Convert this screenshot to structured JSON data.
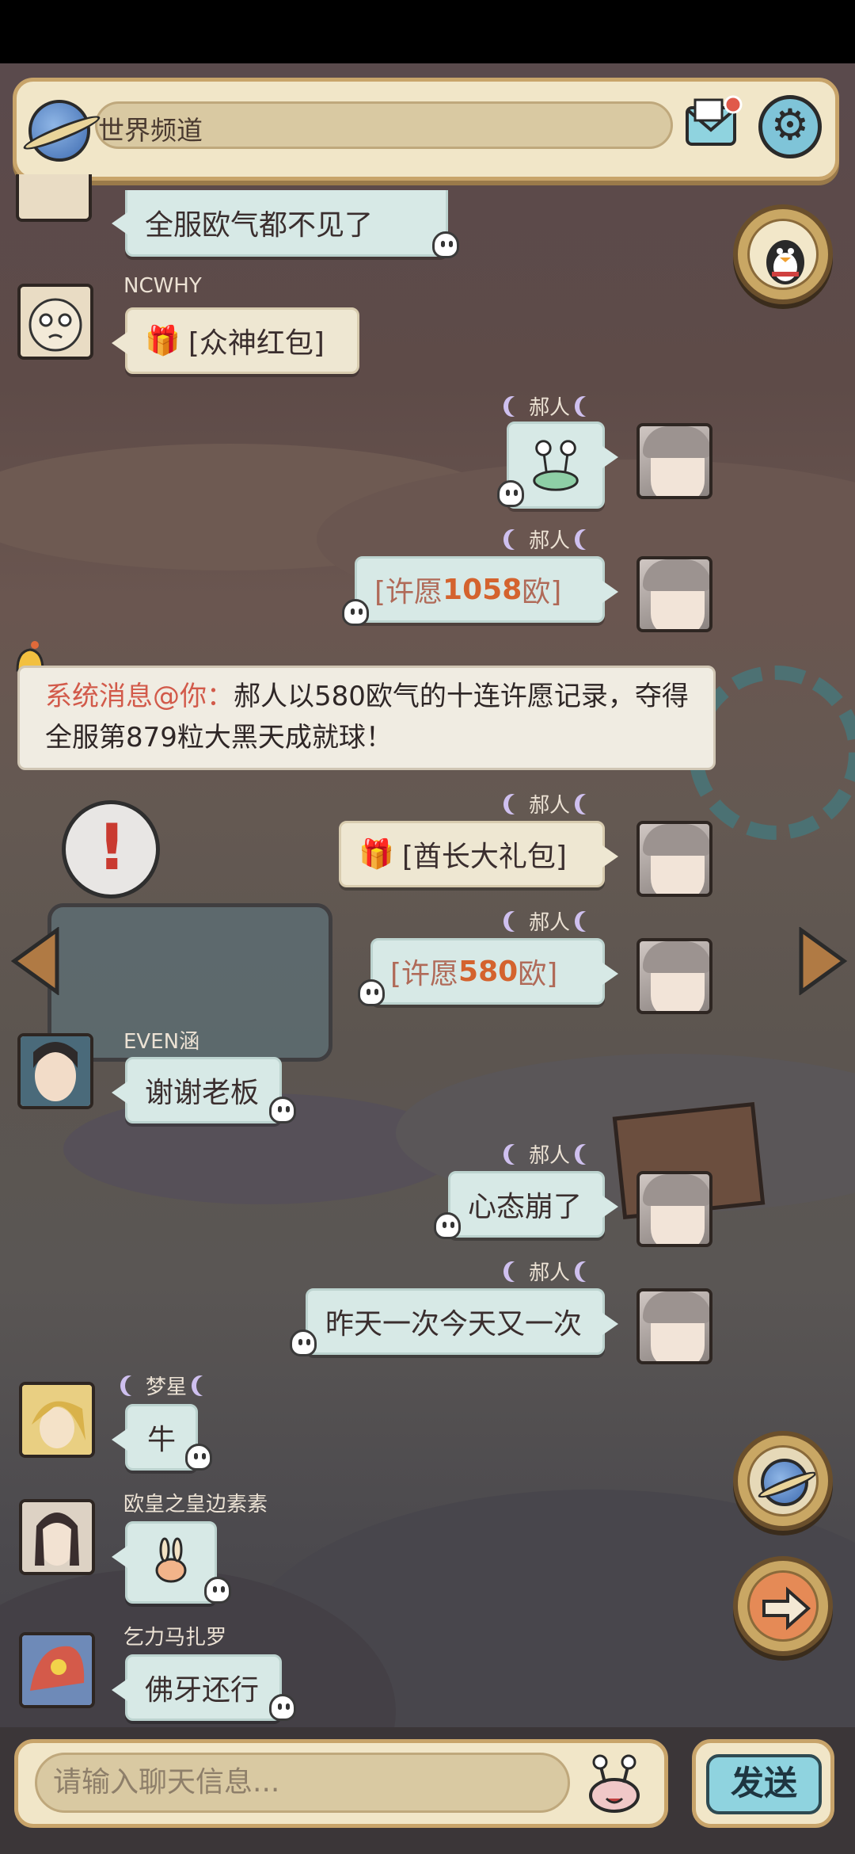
{
  "header": {
    "title": "世界频道",
    "mail_icon": "mail-notification-icon",
    "settings_icon": "gear-icon"
  },
  "messages": {
    "m0": {
      "text": "全服欧气都不见了"
    },
    "m1": {
      "name": "NCWHY",
      "text": "[众神红包]"
    },
    "m2": {
      "name": "郝人"
    },
    "m3": {
      "name": "郝人",
      "wish_prefix": "[许愿 ",
      "wish_value": "1058",
      "wish_suffix": " 欧]"
    },
    "sys": {
      "tag": "系统消息@你：",
      "text": "郝人以580欧气的十连许愿记录，夺得全服第879粒大黑天成就球！"
    },
    "m4": {
      "name": "郝人",
      "text": "[酋长大礼包]"
    },
    "m5": {
      "name": "郝人",
      "wish_prefix": "[许愿 ",
      "wish_value": "580",
      "wish_suffix": " 欧]"
    },
    "m6": {
      "name": "EVEN涵",
      "text": "谢谢老板"
    },
    "m7": {
      "name": "郝人",
      "text": "心态崩了"
    },
    "m8": {
      "name": "郝人",
      "text": "昨天一次今天又一次"
    },
    "m9": {
      "name": "梦星",
      "text": "牛"
    },
    "m10": {
      "name": "欧皇之皇边素素"
    },
    "m11": {
      "name": "乞力马扎罗",
      "text": "佛牙还行"
    }
  },
  "input": {
    "placeholder": "请输入聊天信息..."
  },
  "send": {
    "label": "发送"
  },
  "colors": {
    "accent": "#d4632e",
    "system_tag": "#d25a4a",
    "bubble": "#d7e9e6",
    "frame": "#c8a46a"
  }
}
